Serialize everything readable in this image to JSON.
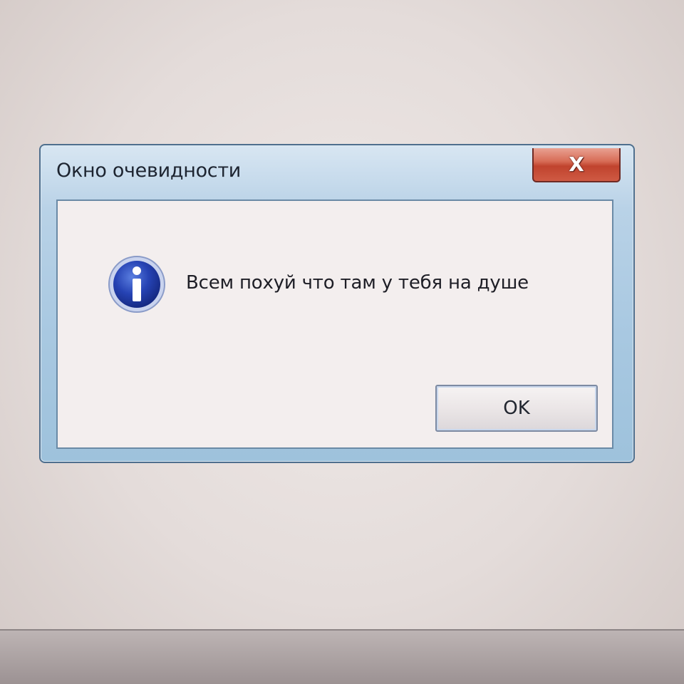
{
  "dialog": {
    "title": "Окно очевидности",
    "message": "Всем похуй что там у тебя на душе",
    "ok_label": "OK",
    "close_label": "X",
    "icon": "info-icon"
  },
  "colors": {
    "frame": "#a8c8e1",
    "close_button": "#c0432e",
    "info_icon": "#1f3fa8"
  }
}
